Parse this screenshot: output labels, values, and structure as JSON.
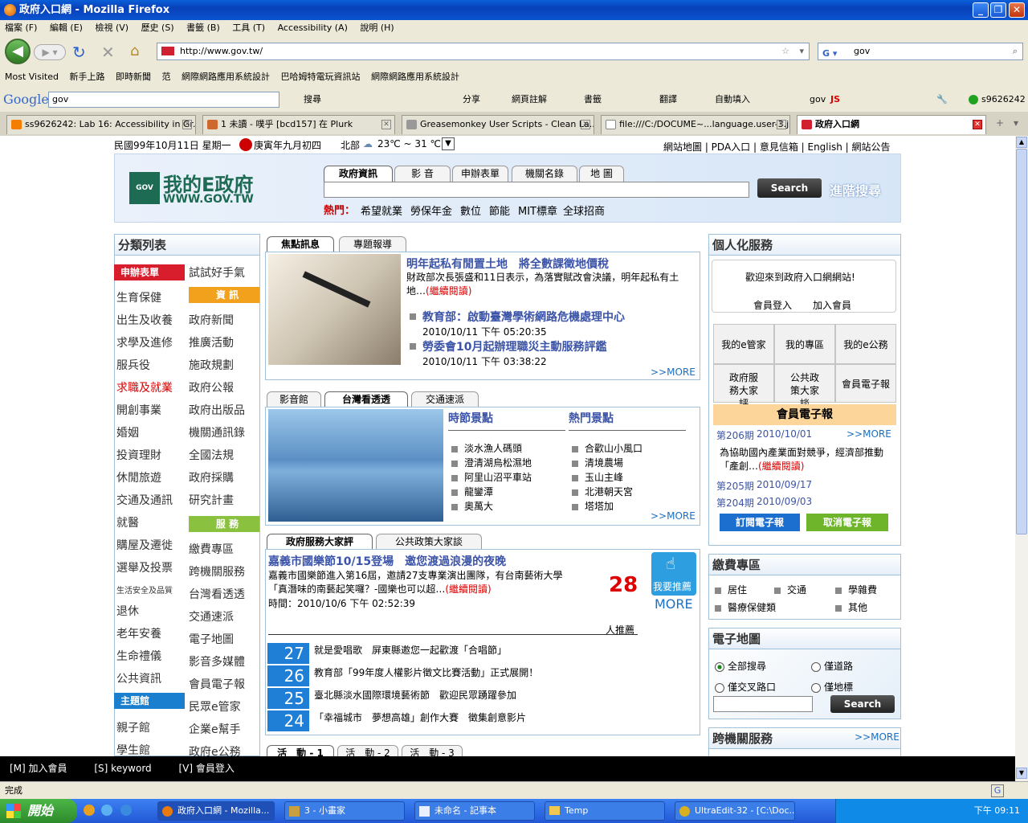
{
  "window": {
    "title": "政府入口網 - Mozilla Firefox"
  },
  "menu": [
    "檔案 (F)",
    "編輯 (E)",
    "檢視 (V)",
    "歷史 (S)",
    "書籤 (B)",
    "工具 (T)",
    "Accessibility (A)",
    "說明 (H)"
  ],
  "nav": {
    "url": "http://www.gov.tw/",
    "search_value": "gov"
  },
  "bookmarks": [
    "Most Visited",
    "新手上路",
    "即時新聞",
    "范",
    "網際網路應用系統設計",
    "巴哈姆特電玩資訊站",
    "網際網路應用系統設計"
  ],
  "googlebar": {
    "logo": "Google",
    "query": "gov",
    "items": [
      "搜尋",
      "分享",
      "網頁註解",
      "書籤",
      "翻譯",
      "自動填入",
      "gov",
      "JS"
    ],
    "user": "s9626242"
  },
  "tabs": [
    {
      "label": "ss9626242: Lab 16: Accessibility in Gr..."
    },
    {
      "label": "1 未讀 - 噗乎 [bcd157] 在 Plurk"
    },
    {
      "label": "Greasemonkey User Scripts - Clean La..."
    },
    {
      "label": "file:///C:/DOCUME~...language.user-3.js"
    },
    {
      "label": "政府入口網"
    }
  ],
  "page": {
    "date": "民國99年10月11日 星期一",
    "lunar": "庚寅年九月初四",
    "weather": "北部",
    "temp": "23℃ ~ 31 ℃",
    "toplinks": "網站地圖 | PDA入口 | 意見信箱 | English | 網站公告",
    "logo_main": "我的E政府",
    "logo_url": "WWW.GOV.TW",
    "logo_gov": "GOV",
    "search_tabs": [
      "政府資訊",
      "影 音",
      "申辦表單",
      "機關名錄",
      "地 圖"
    ],
    "search_button": "Search",
    "adv_search": "進階搜尋",
    "hot_label": "熱門：",
    "hot_items": [
      "希望就業",
      "勞保年金",
      "數位",
      "節能",
      "MIT標章",
      "全球招商"
    ],
    "left": {
      "title": "分類列表",
      "pill_apply": "申辦表單",
      "col1": [
        "生育保健",
        "出生及收養",
        "求學及進修",
        "服兵役",
        "求職及就業",
        "開創事業",
        "婚姻",
        "投資理財",
        "休閒旅遊",
        "交通及通訊",
        "就醫",
        "購屋及遷徙",
        "選舉及投票",
        "生活安全及品質",
        "退休",
        "老年安養",
        "生命禮儀",
        "公共資訊"
      ],
      "pill_theme": "主題館",
      "col1b": [
        "親子館",
        "學生館"
      ],
      "col2_top": "試試好手氣",
      "pill_info": "資 訊",
      "col2": [
        "政府新聞",
        "推廣活動",
        "施政規劃",
        "政府公報",
        "政府出版品",
        "機關通訊錄",
        "全國法規",
        "政府採購",
        "研究計畫"
      ],
      "pill_service": "服 務",
      "col2b": [
        "繳費專區",
        "跨機關服務",
        "台灣看透透",
        "交通速派",
        "電子地圖",
        "影音多媒體",
        "會員電子報",
        "民眾e管家",
        "企業e幫手",
        "政府e公務"
      ]
    },
    "news": {
      "tabs": [
        "焦點訊息",
        "專題報導"
      ],
      "headline": "明年起私有閒置土地　將全數課徵地價稅",
      "summary": "財政部次長張盛和11日表示，為落實賦改會決議，明年起私有土地…",
      "readmore": "(繼續閱讀)",
      "items": [
        {
          "title": "教育部：啟動臺灣學術網路危機處理中心",
          "time": "2010/10/11 下午 05:20:35"
        },
        {
          "title": "勞委會10月起辦理職災主動服務評鑑",
          "time": "2010/10/11 下午 03:38:22"
        }
      ],
      "more": ">>MORE"
    },
    "taiwan": {
      "tabs": [
        "影音館",
        "台灣看透透",
        "交通速派"
      ],
      "col1_title": "時節景點",
      "col1": [
        "淡水漁人碼頭",
        "澄清湖烏松濕地",
        "阿里山沼平車站",
        "龍鑾潭",
        "奧萬大"
      ],
      "col2_title": "熱門景點",
      "col2": [
        "合歡山小風口",
        "清境農場",
        "玉山主峰",
        "北港朝天宮",
        "塔塔加"
      ],
      "more": ">>MORE"
    },
    "review": {
      "tabs": [
        "政府服務大家評",
        "公共政策大家談"
      ],
      "headline": "嘉義市國樂節10/15登場　邀您渡過浪漫的夜晚",
      "summary": "嘉義市國樂節進入第16屆，邀請27支專業演出團隊，有台南藝術大學「真潛味的南藝起笑囉？-國樂也可以超…",
      "readmore": "(繼續閱讀)",
      "time": "時間：2010/10/6 下午 02:52:39",
      "count": "28",
      "recommend_btn": "我要推薦",
      "more": "MORE",
      "people": "人推薦",
      "list": [
        {
          "n": "27",
          "t": "就是愛唱歌　屏東縣邀您一起歡渡「合唱節」"
        },
        {
          "n": "26",
          "t": "教育部「99年度人權影片徵文比賽活動」正式展開！"
        },
        {
          "n": "25",
          "t": "臺北縣淡水國際環境藝術節　歡迎民眾踴躍參加"
        },
        {
          "n": "24",
          "t": "「幸福城市　夢想高雄」創作大賽　徵集創意影片"
        }
      ],
      "bottom_tabs": [
        "活　動 - 1",
        "活　動 - 2",
        "活　動 - 3"
      ]
    },
    "right": {
      "title": "個人化服務",
      "welcome": "歡迎來到政府入口網網站!",
      "login": "會員登入",
      "join": "加入會員",
      "grid": [
        "我的e管家",
        "我的專區",
        "我的e公務",
        "政府服務大家評",
        "公共政策大家談",
        "會員電子報"
      ],
      "epaper_title": "會員電子報",
      "ep1_no": "第206期",
      "ep1_date": "2010/10/01",
      "ep_more": ">>MORE",
      "ep_text": "為協助國內產業面對競爭，經濟部推動「產創…",
      "ep_read": "(繼續閱讀)",
      "ep2_no": "第205期",
      "ep2_date": "2010/09/17",
      "ep3_no": "第204期",
      "ep3_date": "2010/09/03",
      "subscribe": "訂閱電子報",
      "unsubscribe": "取消電子報",
      "fee_title": "繳費專區",
      "fees": [
        "居住",
        "交通",
        "學雜費",
        "醫療保健類",
        "其他"
      ],
      "map_title": "電子地圖",
      "map_opts": [
        "全部搜尋",
        "僅道路",
        "僅交叉路口",
        "僅地標"
      ],
      "map_search": "Search",
      "cross_title": "跨機關服務",
      "cross_more": ">>MORE"
    }
  },
  "access": [
    "[M] 加入會員",
    "[S] keyword",
    "[V] 會員登入"
  ],
  "status": "完成",
  "taskbar": {
    "start": "開始",
    "tasks": [
      "政府入口網 - Mozilla...",
      "3 - 小畫家",
      "未命名 - 記事本",
      "Temp",
      "UltraEdit-32 - [C:\\Doc..."
    ],
    "clock": "下午 09:11"
  }
}
